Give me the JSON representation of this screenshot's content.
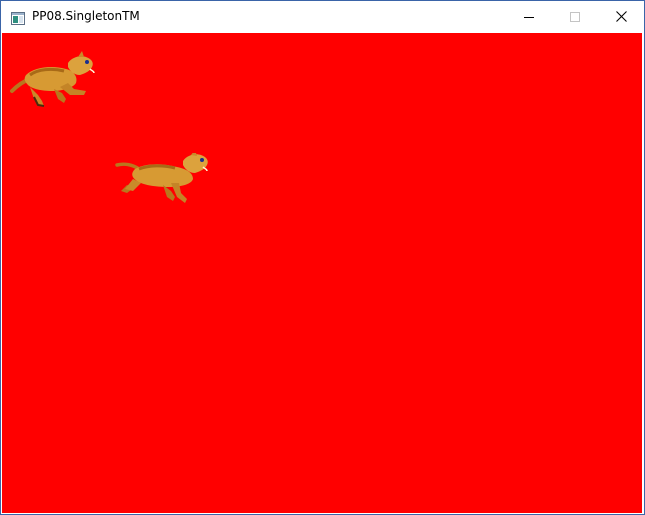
{
  "window": {
    "title": "PP08.SingletonTM",
    "background_color": "#ff0000",
    "icons": {
      "app": "window-app-icon",
      "minimize": "minimize-icon",
      "maximize": "maximize-icon",
      "close": "close-icon"
    }
  },
  "sprites": [
    {
      "name": "running-cat-sprite",
      "kind": "cat"
    },
    {
      "name": "running-cat-sprite",
      "kind": "cat"
    }
  ]
}
